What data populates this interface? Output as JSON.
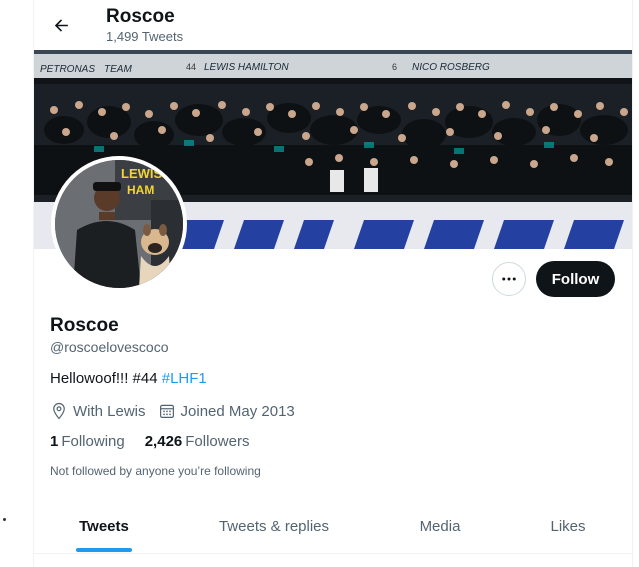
{
  "header": {
    "name": "Roscoe",
    "tweet_count": "1,499 Tweets"
  },
  "banner": {
    "texts": [
      "PETRONAS",
      "TEAM",
      "44",
      "LEWIS HAMILTON",
      "6",
      "NICO ROSBERG"
    ]
  },
  "avatar": {
    "texts": [
      "LEWIS",
      "HAM"
    ]
  },
  "profile": {
    "display_name": "Roscoe",
    "handle": "@roscoelovescoco",
    "bio_text": "Hellowoof!!! #44 ",
    "bio_hashtag": "#LHF1",
    "location": "With Lewis",
    "joined": "Joined May 2013",
    "following_count": "1",
    "following_label": "Following",
    "followers_count": "2,426",
    "followers_label": "Followers",
    "not_followed": "Not followed by anyone you’re following"
  },
  "actions": {
    "more_label": "•••",
    "follow_label": "Follow"
  },
  "tabs": [
    {
      "label": "Tweets",
      "active": true
    },
    {
      "label": "Tweets & replies",
      "active": false
    },
    {
      "label": "Media",
      "active": false
    },
    {
      "label": "Likes",
      "active": false
    }
  ],
  "colors": {
    "accent": "#1d9bf0",
    "text_primary": "#0f1419",
    "text_secondary": "#536471",
    "follow_button_bg": "#0f1419"
  },
  "icons": {
    "back": "arrow-left-icon",
    "location": "location-pin-icon",
    "calendar": "calendar-icon",
    "more": "more-dots-icon"
  }
}
